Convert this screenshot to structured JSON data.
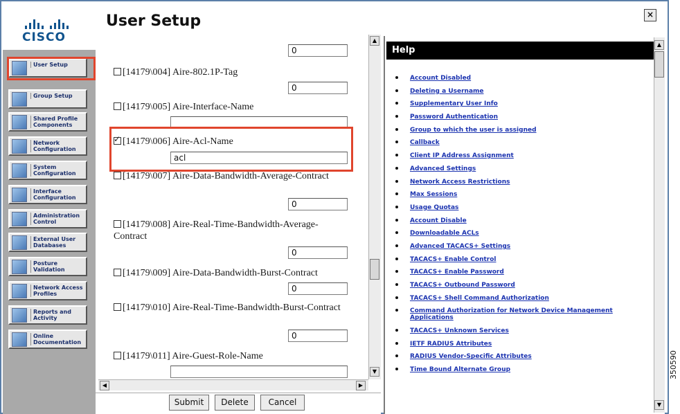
{
  "window": {
    "title": "User Setup",
    "close_glyph": "×"
  },
  "logo": {
    "text": "CISCO"
  },
  "nav": [
    {
      "label": "User Setup",
      "icon": "user-icon"
    },
    {
      "label": "Group Setup",
      "icon": "group-icon"
    },
    {
      "label": "Shared Profile Components",
      "icon": "shared-profile-icon"
    },
    {
      "label": "Network Configuration",
      "icon": "network-icon"
    },
    {
      "label": "System Configuration",
      "icon": "system-icon"
    },
    {
      "label": "Interface Configuration",
      "icon": "interface-icon"
    },
    {
      "label": "Administration Control",
      "icon": "administration-icon"
    },
    {
      "label": "External User Databases",
      "icon": "database-icon"
    },
    {
      "label": "Posture Validation",
      "icon": "posture-icon"
    },
    {
      "label": "Network Access Profiles",
      "icon": "network-access-icon"
    },
    {
      "label": "Reports and Activity",
      "icon": "reports-icon"
    },
    {
      "label": "Online Documentation",
      "icon": "documentation-icon"
    }
  ],
  "form": {
    "top_value": "0",
    "attributes": [
      {
        "label": "[14179\\004] Aire-802.1P-Tag",
        "checked": false,
        "value": "0"
      },
      {
        "label": "[14179\\005] Aire-Interface-Name",
        "checked": false,
        "value": ""
      },
      {
        "label": "[14179\\006] Aire-Acl-Name",
        "checked": true,
        "value": "acl"
      },
      {
        "label": "[14179\\007] Aire-Data-Bandwidth-Average-Contract",
        "checked": false,
        "value": "0"
      },
      {
        "label": "[14179\\008] Aire-Real-Time-Bandwidth-Average-Contract",
        "checked": false,
        "value": "0"
      },
      {
        "label": "[14179\\009] Aire-Data-Bandwidth-Burst-Contract",
        "checked": false,
        "value": "0"
      },
      {
        "label": "[14179\\010] Aire-Real-Time-Bandwidth-Burst-Contract",
        "checked": false,
        "value": "0"
      },
      {
        "label": "[14179\\011] Aire-Guest-Role-Name",
        "checked": false,
        "value": ""
      }
    ],
    "buttons": {
      "submit": "Submit",
      "delete": "Delete",
      "cancel": "Cancel"
    }
  },
  "help": {
    "title": "Help",
    "links": [
      "Account Disabled",
      "Deleting a Username",
      "Supplementary User Info",
      "Password Authentication",
      "Group to which the user is assigned",
      "Callback",
      "Client IP Address Assignment",
      "Advanced Settings",
      "Network Access Restrictions",
      "Max Sessions",
      "Usage Quotas",
      "Account Disable",
      "Downloadable ACLs",
      "Advanced TACACS+ Settings",
      "TACACS+ Enable Control",
      "TACACS+ Enable Password",
      "TACACS+ Outbound Password",
      "TACACS+ Shell Command Authorization",
      "Command Authorization for Network Device Management Applications",
      "TACACS+ Unknown Services",
      "IETF RADIUS Attributes",
      "RADIUS Vendor-Specific Attributes",
      "Time Bound Alternate Group"
    ]
  },
  "figure_id": "350590",
  "colors": {
    "highlight": "#e0452d",
    "cisco_blue": "#11548e",
    "help_link": "#1b33b0",
    "nav_bg": "#a9a9a9"
  }
}
